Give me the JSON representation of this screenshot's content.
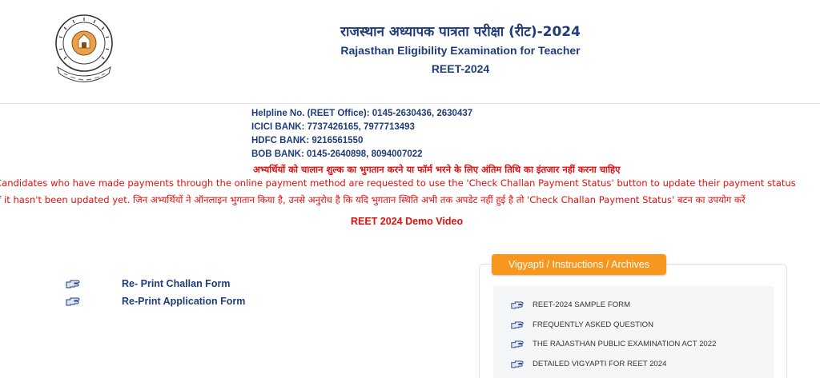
{
  "header": {
    "title_hindi": "राजस्थान अध्यापक पात्रता परीक्षा (रीट)-2024",
    "title_english": "Rajasthan Eligibility Examination for Teacher",
    "exam_code": "REET-2024",
    "logo_icon": "board-of-secondary-education-rajasthan-seal-icon",
    "logo_text": "BOARD OF SECONDARY EDUCATION RAJASTHAN"
  },
  "helpline": [
    "Helpline No. (REET Office): 0145-2630436, 2630437",
    "ICICI BANK: 7737426165, 7977713493",
    "HDFC BANK: 9216561550",
    "BOB BANK: 0145-2640898, 8094007022"
  ],
  "hindi_warning": "अभ्यर्थियों को चालान शुल्क का भुगतान करने या फॉर्म भरने के लिए अंतिम तिथि का इंतजार नहीं करना चाहिए",
  "notice": {
    "line1": "Candidates who have made payments through the online payment method are requested to use the 'Check Challan Payment Status' button to update their payment status",
    "line2": "if it hasn't been updated yet. जिन अभ्यर्थियों ने ऑनलाइन भुगतान किया है, उनसे अनुरोध है कि यदि भुगतान स्थिति अभी तक अपडेट नहीं हुई है तो 'Check Challan Payment Status' बटन का उपयोग करें"
  },
  "demo_video_label": "REET 2024 Demo Video",
  "left_links": [
    {
      "label": "Re- Print Challan Form",
      "icon": "pointing-hand-icon"
    },
    {
      "label": "Re-Print Application Form",
      "icon": "pointing-hand-icon"
    }
  ],
  "panel": {
    "title": "Vigyapti / Instructions / Archives",
    "items": [
      {
        "label": "REET-2024 SAMPLE FORM",
        "icon": "pointing-hand-icon"
      },
      {
        "label": "FREQUENTLY ASKED QUESTION",
        "icon": "pointing-hand-icon"
      },
      {
        "label": "THE RAJASTHAN PUBLIC EXAMINATION ACT 2022",
        "icon": "pointing-hand-icon"
      },
      {
        "label": "DETAILED VIGYAPTI FOR REET 2024",
        "icon": "pointing-hand-icon"
      }
    ]
  },
  "colors": {
    "navy": "#1f3d7a",
    "alert_red": "#e01010",
    "tab_orange": "#f7971e"
  }
}
